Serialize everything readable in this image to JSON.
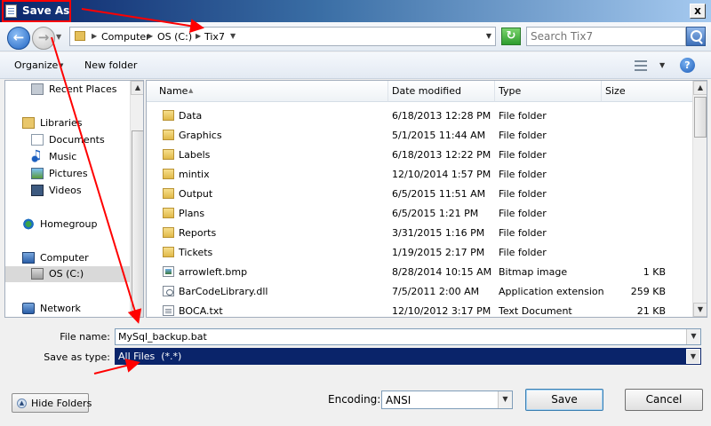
{
  "window": {
    "title": "Save As",
    "close_symbol": "x"
  },
  "navbar": {
    "back_icon": "back-arrow-icon",
    "forward_icon": "forward-arrow-icon",
    "breadcrumbs": [
      "Computer",
      "OS (C:)",
      "Tix7"
    ],
    "search_placeholder": "Search Tix7"
  },
  "toolbar": {
    "organize_label": "Organize",
    "new_folder_label": "New folder",
    "help_symbol": "?"
  },
  "sidebar": {
    "items": [
      {
        "label": "Recent Places",
        "icon": "recent-places-icon"
      },
      {
        "label": "Libraries",
        "icon": "libraries-icon"
      },
      {
        "label": "Documents",
        "icon": "documents-icon"
      },
      {
        "label": "Music",
        "icon": "music-icon"
      },
      {
        "label": "Pictures",
        "icon": "pictures-icon"
      },
      {
        "label": "Videos",
        "icon": "videos-icon"
      },
      {
        "label": "Homegroup",
        "icon": "homegroup-icon"
      },
      {
        "label": "Computer",
        "icon": "computer-icon"
      },
      {
        "label": "OS (C:)",
        "icon": "drive-icon",
        "selected": true
      },
      {
        "label": "Network",
        "icon": "network-icon"
      }
    ]
  },
  "files": {
    "columns": [
      "Name",
      "Date modified",
      "Type",
      "Size"
    ],
    "rows": [
      {
        "name": "Data",
        "date": "6/18/2013 12:28 PM",
        "type": "File folder",
        "size": "",
        "icon": "folder-icon"
      },
      {
        "name": "Graphics",
        "date": "5/1/2015 11:44 AM",
        "type": "File folder",
        "size": "",
        "icon": "folder-icon"
      },
      {
        "name": "Labels",
        "date": "6/18/2013 12:22 PM",
        "type": "File folder",
        "size": "",
        "icon": "folder-icon"
      },
      {
        "name": "mintix",
        "date": "12/10/2014 1:57 PM",
        "type": "File folder",
        "size": "",
        "icon": "folder-icon"
      },
      {
        "name": "Output",
        "date": "6/5/2015 11:51 AM",
        "type": "File folder",
        "size": "",
        "icon": "folder-icon"
      },
      {
        "name": "Plans",
        "date": "6/5/2015 1:21 PM",
        "type": "File folder",
        "size": "",
        "icon": "folder-icon"
      },
      {
        "name": "Reports",
        "date": "3/31/2015 1:16 PM",
        "type": "File folder",
        "size": "",
        "icon": "folder-icon"
      },
      {
        "name": "Tickets",
        "date": "1/19/2015 2:17 PM",
        "type": "File folder",
        "size": "",
        "icon": "folder-icon"
      },
      {
        "name": "arrowleft.bmp",
        "date": "8/28/2014 10:15 AM",
        "type": "Bitmap image",
        "size": "1 KB",
        "icon": "bitmap-file-icon"
      },
      {
        "name": "BarCodeLibrary.dll",
        "date": "7/5/2011 2:00 AM",
        "type": "Application extension",
        "size": "259 KB",
        "icon": "dll-file-icon"
      },
      {
        "name": "BOCA.txt",
        "date": "12/10/2012 3:17 PM",
        "type": "Text Document",
        "size": "21 KB",
        "icon": "text-file-icon"
      }
    ]
  },
  "form": {
    "file_name_label": "File name:",
    "file_name_value": "MySql_backup.bat",
    "save_type_label": "Save as type:",
    "save_type_value": "All Files  (*.*)",
    "encoding_label": "Encoding:",
    "encoding_value": "ANSI"
  },
  "buttons": {
    "hide_folders": "Hide Folders",
    "save": "Save",
    "cancel": "Cancel"
  },
  "annotations": {
    "color": "#ff0000"
  }
}
